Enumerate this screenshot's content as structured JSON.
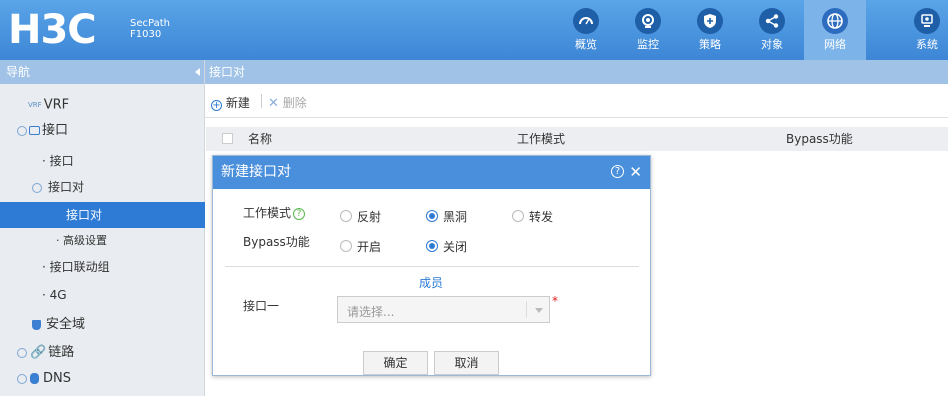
{
  "brand": {
    "logo": "H3C",
    "line1": "SecPath",
    "line2": "F1030"
  },
  "topnav": [
    {
      "label": "概览",
      "icon": "gauge-icon"
    },
    {
      "label": "监控",
      "icon": "monitor-eye-icon"
    },
    {
      "label": "策略",
      "icon": "shield-plus-icon"
    },
    {
      "label": "对象",
      "icon": "share-icon"
    },
    {
      "label": "网络",
      "icon": "globe-icon",
      "active": true
    },
    {
      "label": "系统",
      "icon": "system-icon"
    }
  ],
  "sidebar": {
    "title": "导航",
    "items": [
      {
        "label": "VRF",
        "badge": "VRF"
      },
      {
        "label": "接口"
      },
      {
        "label": "· 接口"
      },
      {
        "label": "接口对"
      },
      {
        "label": "接口对",
        "selected": true
      },
      {
        "label": "· 高级设置"
      },
      {
        "label": "· 接口联动组"
      },
      {
        "label": "· 4G"
      },
      {
        "label": "安全域"
      },
      {
        "label": "链路"
      },
      {
        "label": "DNS"
      }
    ]
  },
  "main": {
    "breadcrumb": "接口对",
    "toolbar": {
      "new_label": "新建",
      "delete_label": "删除"
    },
    "table": {
      "columns": [
        "名称",
        "工作模式",
        "Bypass功能"
      ]
    }
  },
  "dialog": {
    "title": "新建接口对",
    "mode_label": "工作模式",
    "mode_options": [
      {
        "label": "反射",
        "checked": false
      },
      {
        "label": "黑洞",
        "checked": true
      },
      {
        "label": "转发",
        "checked": false
      }
    ],
    "bypass_label": "Bypass功能",
    "bypass_options": [
      {
        "label": "开启",
        "checked": false
      },
      {
        "label": "关闭",
        "checked": true
      }
    ],
    "section_title": "成员",
    "iface_label": "接口一",
    "iface_placeholder": "请选择...",
    "required_mark": "*",
    "ok_label": "确定",
    "cancel_label": "取消"
  }
}
